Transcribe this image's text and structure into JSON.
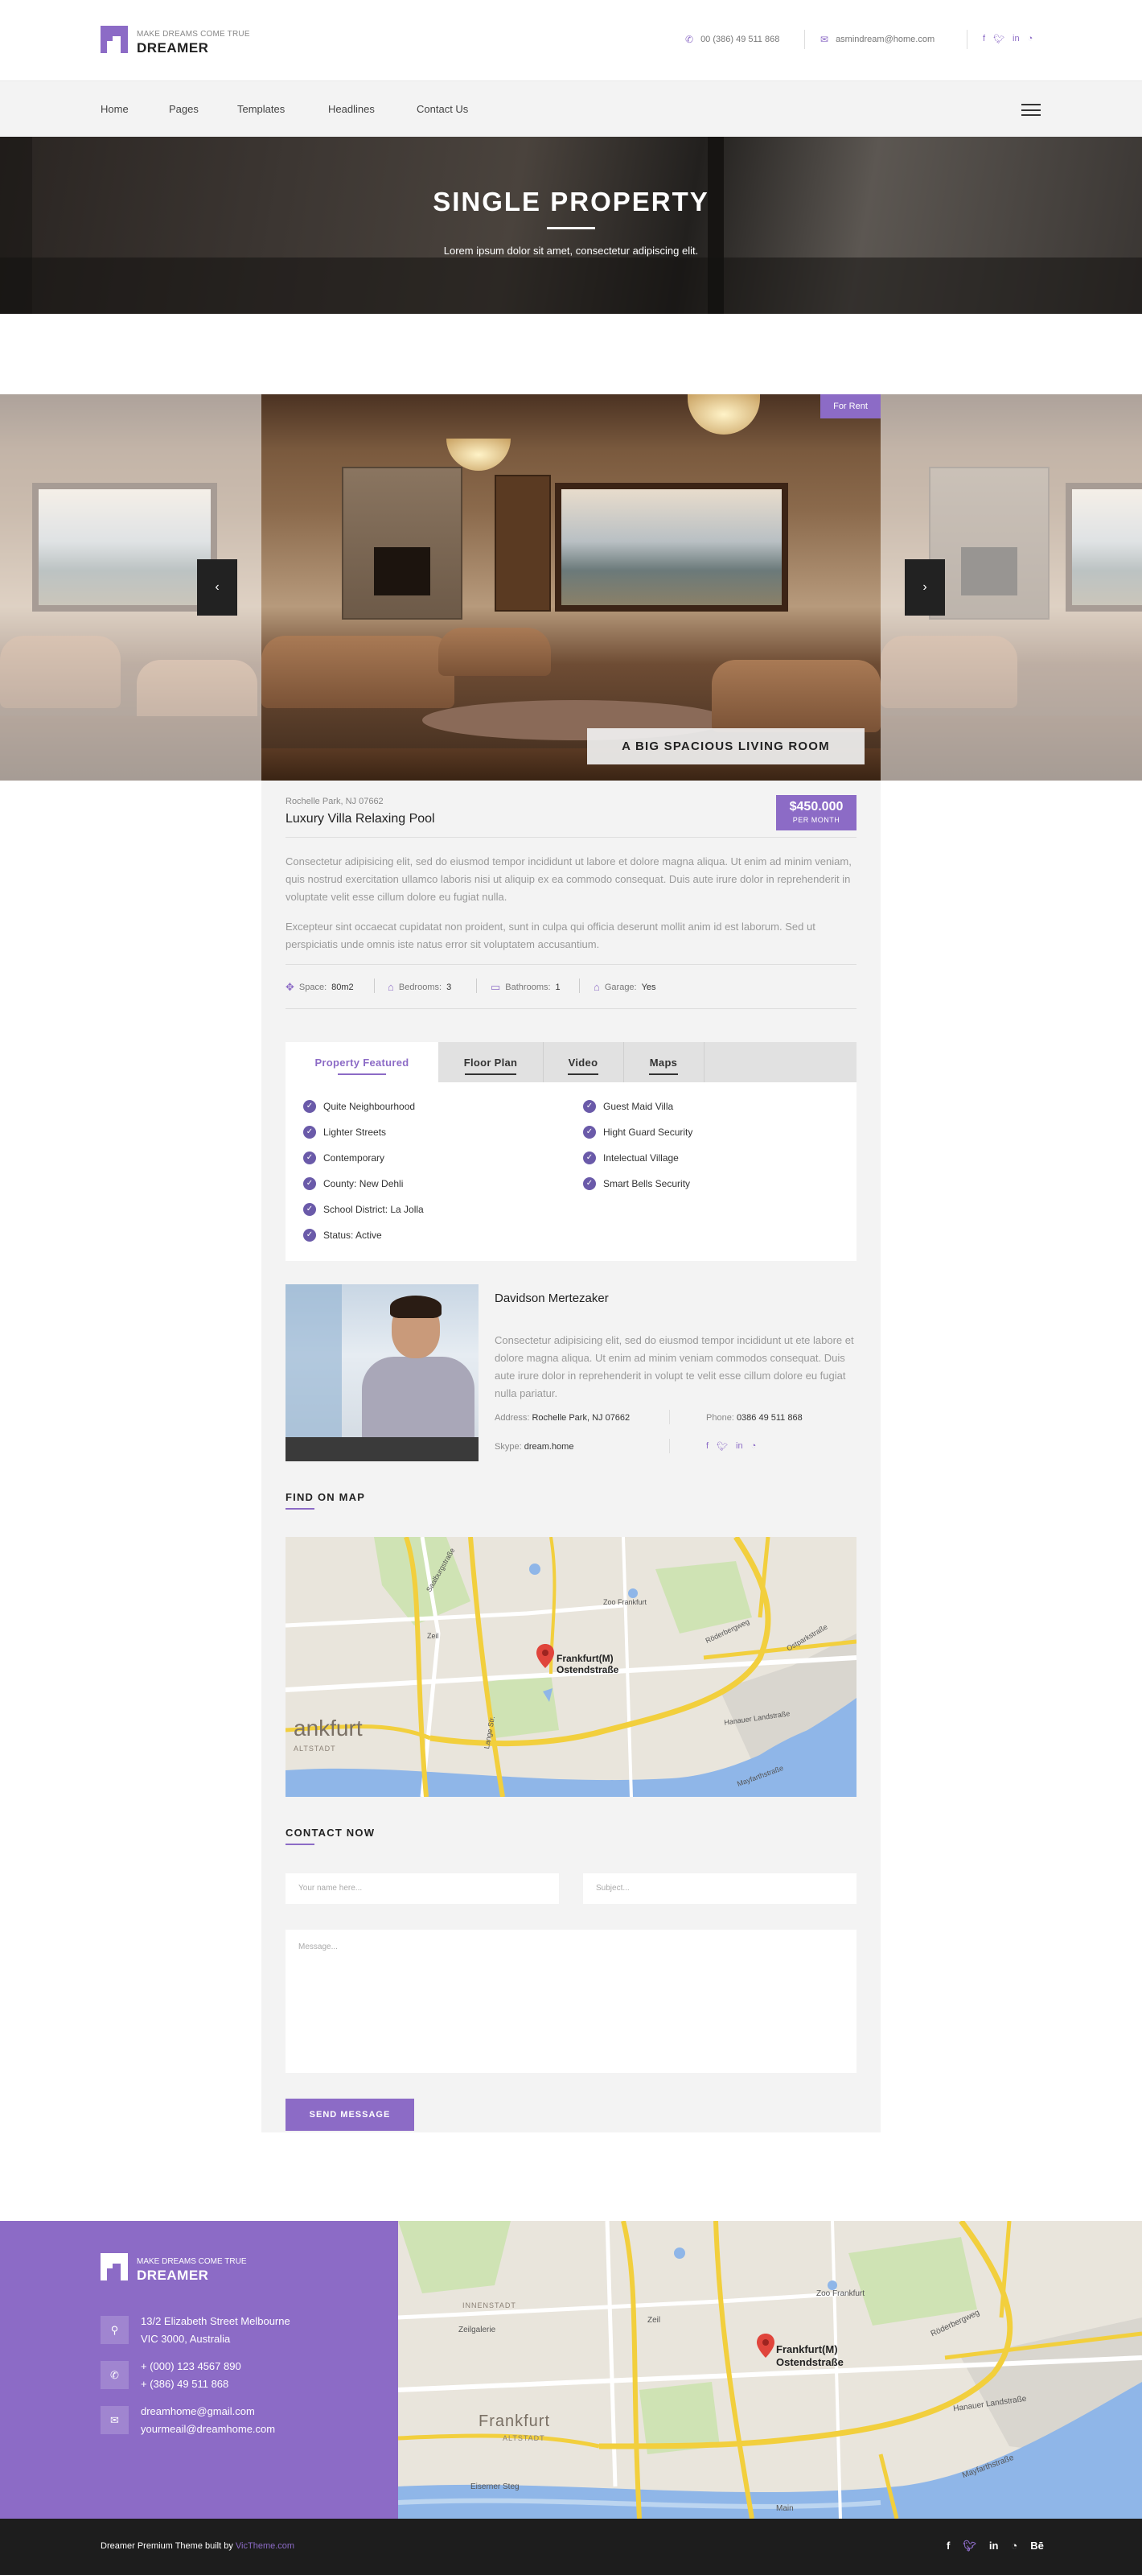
{
  "brand": {
    "tagline": "MAKE DREAMS COME TRUE",
    "name": "DREAMER",
    "accent": "#8c6bc6"
  },
  "header": {
    "phone": "00 (386) 49 511 868",
    "email": "asmindream@home.com",
    "social": [
      "f",
      "t",
      "in",
      "rss"
    ]
  },
  "nav": {
    "items": [
      "Home",
      "Pages",
      "Templates",
      "Headlines",
      "Contact Us"
    ]
  },
  "hero": {
    "title": "SINGLE PROPERTY",
    "subtitle": "Lorem ipsum dolor sit amet, consectetur adipiscing elit."
  },
  "slider": {
    "badge": "For Rent",
    "caption": "A BIG SPACIOUS LIVING ROOM",
    "prev": "‹",
    "next": "›"
  },
  "property": {
    "address": "Rochelle Park, NJ 07662",
    "title": "Luxury Villa Relaxing Pool",
    "price": "$450.000",
    "price_period": "PER MONTH",
    "desc1": "Consectetur adipisicing elit, sed do eiusmod tempor incididunt ut labore et dolore magna aliqua. Ut enim ad minim veniam, quis nostrud exercitation ullamco laboris nisi ut aliquip ex ea commodo consequat. Duis aute irure dolor in reprehenderit in voluptate velit esse cillum dolore eu fugiat nulla.",
    "desc2": "Excepteur sint occaecat cupidatat non proident, sunt in culpa qui officia deserunt mollit anim id est laborum. Sed ut perspiciatis unde omnis iste natus error sit voluptatem accusantium.",
    "features": [
      {
        "label": "Space:",
        "value": "80m2"
      },
      {
        "label": "Bedrooms:",
        "value": "3"
      },
      {
        "label": "Bathrooms:",
        "value": "1"
      },
      {
        "label": "Garage:",
        "value": "Yes"
      }
    ]
  },
  "tabs": {
    "items": [
      "Property Featured",
      "Floor Plan",
      "Video",
      "Maps"
    ],
    "active": 0,
    "left_list": [
      "Quite Neighbourhood",
      "Lighter Streets",
      "Contemporary",
      "County: New Dehli",
      "School District: La Jolla",
      "Status: Active"
    ],
    "right_list": [
      "Guest Maid Villa",
      "Hight Guard Security",
      "Intelectual Village",
      "Smart Bells Security"
    ]
  },
  "agent": {
    "name": "Davidson Mertezaker",
    "bio": "Consectetur adipisicing elit, sed do eiusmod tempor incididunt ut ete labore et dolore magna aliqua. Ut enim ad minim veniam commodos consequat. Duis aute irure dolor in reprehenderit in volupt te velit esse cillum dolore eu fugiat nulla pariatur.",
    "address_label": "Address:",
    "address": "Rochelle Park, NJ 07662",
    "phone_label": "Phone:",
    "phone": "0386 49 511 868",
    "skype_label": "Skype:",
    "skype": "dream.home",
    "social": [
      "f",
      "t",
      "in",
      "rss"
    ]
  },
  "map_section": {
    "title": "FIND ON MAP",
    "pin_label_1": "Frankfurt(M)",
    "pin_label_2": "Ostendstraße",
    "city": "ankfurt",
    "district": "ALTSTADT",
    "labels": {
      "zoo": "Zoo Frankfurt",
      "zeil": "Zeil",
      "roeder": "Röderbergweg",
      "hanauer": "Hanauer Landstraße",
      "lange": "Lange Str.",
      "mayfarth": "Mayfarthstraße",
      "saalburg": "Saalburgstraße",
      "ostpark": "Ostparkstraße"
    }
  },
  "contact": {
    "title": "CONTACT NOW",
    "name_placeholder": "Your name here...",
    "subject_placeholder": "Subject...",
    "message_placeholder": "Message...",
    "send": "SEND MESSAGE"
  },
  "footer": {
    "tagline": "MAKE DREAMS COME TRUE",
    "name": "DREAMER",
    "address1": "13/2 Elizabeth Street Melbourne",
    "address2": "VIC 3000, Australia",
    "phone1": "+ (000) 123 4567 890",
    "phone2": "+ (386) 49 511 868",
    "email1": "dreamhome@gmail.com",
    "email2": "yourmeail@dreamhome.com",
    "map": {
      "pin_label_1": "Frankfurt(M)",
      "pin_label_2": "Ostendstraße",
      "city": "Frankfurt",
      "district": "ALTSTADT",
      "innenstadt": "INNENSTADT",
      "zeil": "Zeil",
      "zeilgalerie": "Zeilgalerie",
      "zoo": "Zoo Frankfurt",
      "roeder": "Röderbergweg",
      "hanauer": "Hanauer Landstraße",
      "eiserner": "Eiserner Steg",
      "mayfarth": "Mayfarthstraße",
      "main": "Main"
    },
    "copyright_text": "Dreamer Premium Theme built by",
    "copyright_link": "VicTheme.com",
    "social": [
      "f",
      "t",
      "in",
      "rss",
      "Bē"
    ]
  }
}
